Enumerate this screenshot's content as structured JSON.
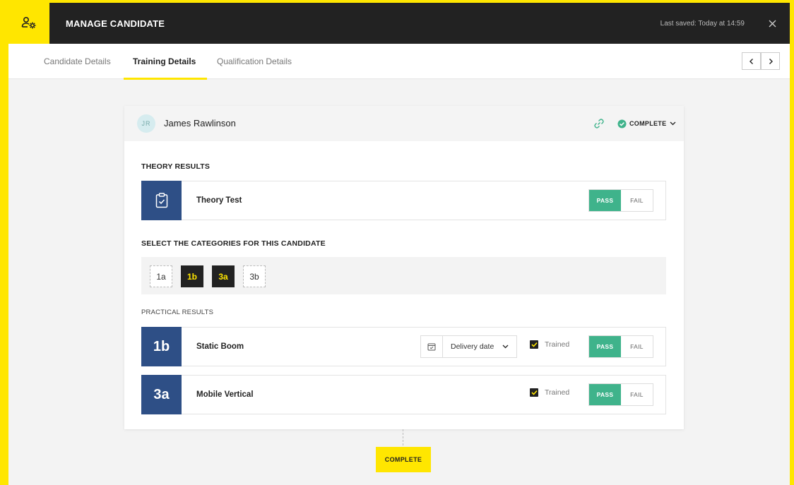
{
  "header": {
    "title": "MANAGE CANDIDATE",
    "last_saved": "Last saved: Today at 14:59"
  },
  "tabs": [
    {
      "label": "Candidate Details",
      "active": false
    },
    {
      "label": "Training Details",
      "active": true
    },
    {
      "label": "Qualification Details",
      "active": false
    }
  ],
  "candidate": {
    "initials": "JR",
    "name": "James Rawlinson",
    "status": "COMPLETE"
  },
  "theory": {
    "section_title": "THEORY RESULTS",
    "test_label": "Theory Test",
    "pass_label": "PASS",
    "fail_label": "FAIL",
    "selected": "PASS"
  },
  "categories": {
    "section_title": "SELECT THE CATEGORIES FOR THIS CANDIDATE",
    "items": [
      {
        "label": "1a",
        "selected": false
      },
      {
        "label": "1b",
        "selected": true
      },
      {
        "label": "3a",
        "selected": true
      },
      {
        "label": "3b",
        "selected": false
      }
    ]
  },
  "practical": {
    "section_title": "PRACTICAL RESULTS",
    "rows": [
      {
        "code": "1b",
        "label": "Static Boom",
        "date_placeholder": "Delivery date",
        "trained_label": "Trained",
        "trained": true,
        "pass_label": "PASS",
        "fail_label": "FAIL",
        "selected": "PASS"
      },
      {
        "code": "3a",
        "label": "Mobile Vertical",
        "trained_label": "Trained",
        "trained": true,
        "pass_label": "PASS",
        "fail_label": "FAIL",
        "selected": "PASS"
      }
    ]
  },
  "footer": {
    "complete_label": "COMPLETE"
  },
  "colors": {
    "accent": "#ffe600",
    "header_bg": "#222222",
    "badge_blue": "#2e4f86",
    "pass_green": "#3fb38b"
  },
  "icons": [
    "manage-users-icon",
    "close-icon",
    "chevron-left-icon",
    "chevron-right-icon",
    "link-icon",
    "check-circle-icon",
    "chevron-down-icon",
    "clipboard-check-icon",
    "calendar-icon",
    "checkbox-checked-icon"
  ]
}
